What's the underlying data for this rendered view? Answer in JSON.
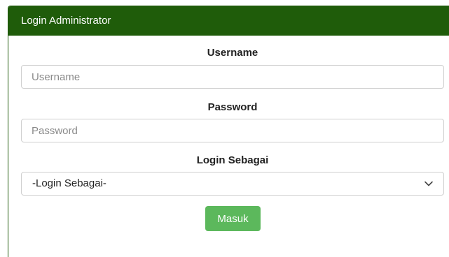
{
  "panel": {
    "title": "Login Administrator",
    "header_color": "#1f5c0a"
  },
  "form": {
    "username": {
      "label": "Username",
      "placeholder": "Username"
    },
    "password": {
      "label": "Password",
      "placeholder": "Password"
    },
    "role": {
      "label": "Login Sebagai",
      "selected": "-Login Sebagai-",
      "icon": "chevron-down-icon"
    },
    "submit_label": "Masuk",
    "submit_color": "#5cb85c"
  }
}
